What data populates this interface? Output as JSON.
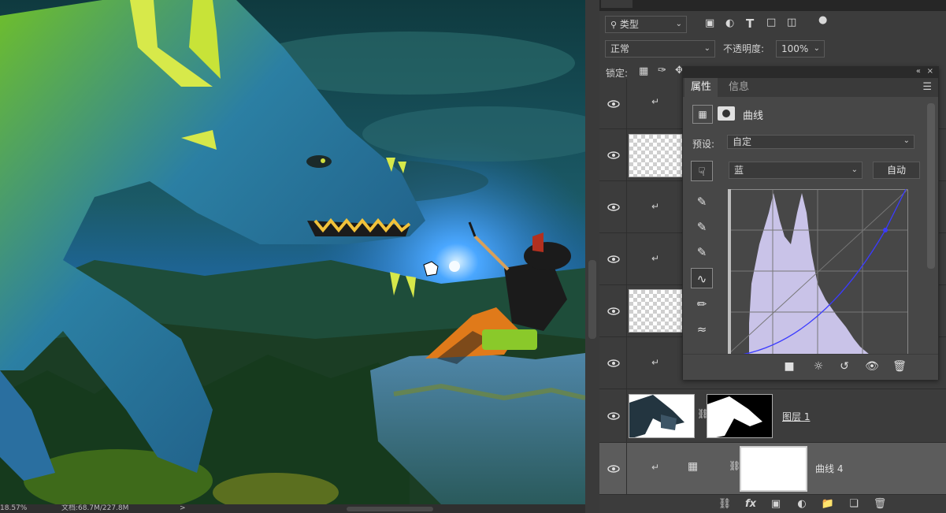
{
  "status": {
    "zoom": "18.57%",
    "document": "文档:68.7M/227.8M",
    "arrow": ">"
  },
  "layers_panel": {
    "filter_kind": "类型",
    "blend_mode": "正常",
    "opacity_label": "不透明度:",
    "opacity_value": "100%",
    "lock_label": "锁定:",
    "layers": [
      {
        "name": "",
        "clipped": true,
        "visible": true
      },
      {
        "name": "",
        "clipped": false,
        "visible": true
      },
      {
        "name": "",
        "clipped": true,
        "visible": true
      },
      {
        "name": "",
        "clipped": true,
        "visible": true
      },
      {
        "name": "",
        "clipped": false,
        "visible": true
      },
      {
        "name": "",
        "clipped": true,
        "visible": true
      },
      {
        "name": "图层 1",
        "clipped": false,
        "visible": true
      },
      {
        "name": "曲线 4",
        "clipped": true,
        "visible": true,
        "selected": true
      }
    ]
  },
  "properties_panel": {
    "tab_properties": "属性",
    "tab_info": "信息",
    "adjustment_name": "曲线",
    "preset_label": "预设:",
    "preset_value": "自定",
    "channel_value": "蓝",
    "auto_button": "自动"
  },
  "colors": {
    "panel_bg": "#3c3c3c",
    "selected_row": "#5c5c5c",
    "histogram": "#c9c3e8",
    "curve": "#3b3bff"
  }
}
